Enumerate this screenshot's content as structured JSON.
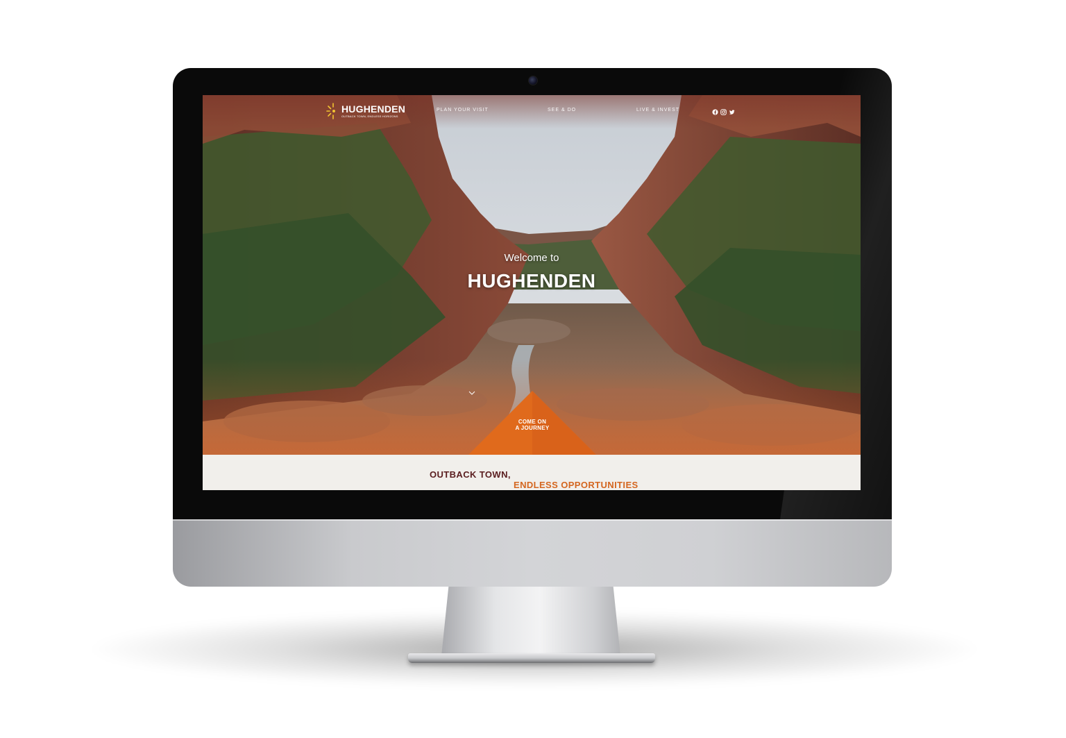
{
  "site": {
    "logo_title": "HUGHENDEN",
    "logo_tagline": "OUTBACK TOWN, ENDLESS HORIZONS",
    "logo_icon": "sunburst-icon"
  },
  "nav": {
    "items": [
      {
        "label": "PLAN YOUR VISIT"
      },
      {
        "label": "SEE & DO"
      },
      {
        "label": "LIVE & INVEST"
      }
    ],
    "social_icons": [
      "facebook-icon",
      "instagram-icon",
      "twitter-icon"
    ]
  },
  "hero": {
    "welcome": "Welcome to",
    "title": "HUGHENDEN",
    "cta_line1": "COME ON",
    "cta_line2": "A JOURNEY",
    "cta_icon": "chevron-down-icon"
  },
  "intro": {
    "line1": "OUTBACK TOWN,",
    "line2": "ENDLESS OPPORTUNITIES"
  },
  "colors": {
    "brand_maroon": "#5a1d1f",
    "brand_orange": "#d4661f",
    "cta_orange": "#e06a1c",
    "logo_yellow": "#f2c431",
    "lower_bg": "#f1efeb",
    "bezel": "#0a0a0a"
  }
}
